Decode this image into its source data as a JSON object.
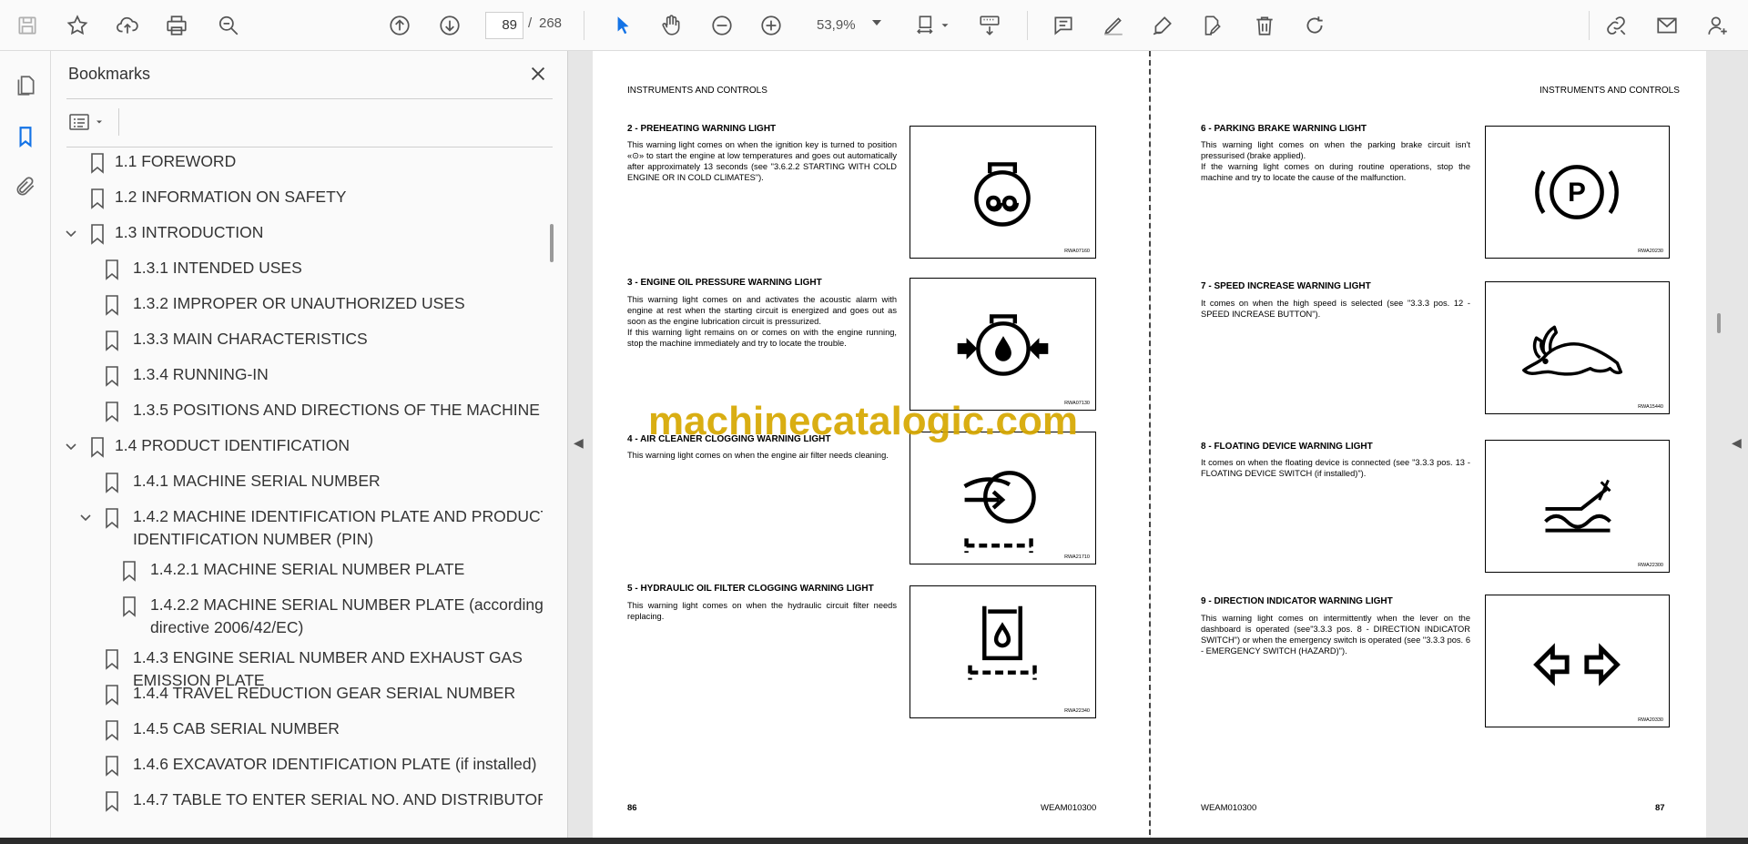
{
  "toolbar": {
    "page_current": "89",
    "page_separator": "/",
    "page_total": "268",
    "zoom_value": "53,9%"
  },
  "bookmarks": {
    "title": "Bookmarks",
    "items": [
      {
        "label": "1.1 FOREWORD",
        "level": 1,
        "expander": "none"
      },
      {
        "label": "1.2 INFORMATION ON SAFETY",
        "level": 1,
        "expander": "none"
      },
      {
        "label": "1.3 INTRODUCTION",
        "level": 1,
        "expander": "expanded"
      },
      {
        "label": "1.3.1 INTENDED USES",
        "level": 2,
        "expander": "none"
      },
      {
        "label": "1.3.2 IMPROPER OR UNAUTHORIZED USES",
        "level": 2,
        "expander": "none"
      },
      {
        "label": "1.3.3 MAIN CHARACTERISTICS",
        "level": 2,
        "expander": "none"
      },
      {
        "label": "1.3.4 RUNNING-IN",
        "level": 2,
        "expander": "none"
      },
      {
        "label": "1.3.5 POSITIONS AND DIRECTIONS OF THE MACHINE",
        "level": 2,
        "expander": "none"
      },
      {
        "label": "1.4 PRODUCT IDENTIFICATION",
        "level": 1,
        "expander": "expanded"
      },
      {
        "label": "1.4.1 MACHINE SERIAL NUMBER",
        "level": 2,
        "expander": "none"
      },
      {
        "label": "1.4.2 MACHINE IDENTIFICATION PLATE AND PRODUCT",
        "label2": "IDENTIFICATION NUMBER (PIN)",
        "level": 2,
        "expander": "expanded"
      },
      {
        "label": "1.4.2.1 MACHINE SERIAL NUMBER PLATE",
        "level": 3,
        "expander": "none"
      },
      {
        "label": "1.4.2.2 MACHINE SERIAL NUMBER PLATE (according",
        "label2": "directive 2006/42/EC)",
        "level": 3,
        "expander": "none"
      },
      {
        "label": "1.4.3 ENGINE SERIAL NUMBER AND EXHAUST GAS",
        "label2": "EMISSION PLATE",
        "level": 2,
        "expander": "none"
      },
      {
        "label": "1.4.4 TRAVEL REDUCTION GEAR SERIAL NUMBER",
        "level": 2,
        "expander": "none"
      },
      {
        "label": "1.4.5 CAB SERIAL NUMBER",
        "level": 2,
        "expander": "none"
      },
      {
        "label": "1.4.6 EXCAVATOR IDENTIFICATION PLATE (if installed)",
        "level": 2,
        "expander": "none"
      },
      {
        "label": "1.4.7 TABLE TO ENTER SERIAL NO. AND DISTRIBUTOR",
        "level": 2,
        "expander": "none"
      }
    ]
  },
  "document": {
    "left_page": {
      "header": "INSTRUMENTS AND CONTROLS",
      "footer_page": "86",
      "footer_code": "WEAM010300",
      "sections": [
        {
          "title": "2 -   PREHEATING WARNING LIGHT",
          "body": "This warning light comes on when the ignition key is turned to position «⊙» to start the engine at low temperatures and goes out automatically after approximately 13 seconds (see \"3.6.2.2 STARTING WITH COLD ENGINE OR IN COLD CLIMATES\").",
          "figure_code": "RWA07160",
          "icon": "preheating-icon"
        },
        {
          "title": "3 -   ENGINE OIL PRESSURE WARNING LIGHT",
          "body": "This warning light comes on and activates the acoustic alarm with engine at rest when the starting circuit is energized and goes out as soon as the engine lubrication circuit is pressurized.\nIf this warning light remains on or comes on with the engine running, stop the machine immediately and try to locate the trouble.",
          "figure_code": "RWA07130",
          "icon": "oil-pressure-icon"
        },
        {
          "title": "4 -   AIR CLEANER CLOGGING WARNING LIGHT",
          "body": "This warning light comes on when the engine air filter needs cleaning.",
          "figure_code": "RWA21710",
          "icon": "air-cleaner-icon"
        },
        {
          "title": "5 -   HYDRAULIC OIL FILTER CLOGGING WARNING LIGHT",
          "body": "This warning light comes on when the hydraulic circuit filter needs replacing.",
          "figure_code": "RWA22340",
          "icon": "hydraulic-filter-icon"
        }
      ]
    },
    "right_page": {
      "header": "INSTRUMENTS AND CONTROLS",
      "footer_page": "87",
      "footer_code": "WEAM010300",
      "sections": [
        {
          "title": "6 -   PARKING BRAKE WARNING LIGHT",
          "body": "This warning light comes on when the parking brake circuit isn't pressurised (brake applied).\nIf the warning light comes on during routine operations, stop the machine and try to locate the cause of the malfunction.",
          "figure_code": "RWA20230",
          "icon": "parking-brake-icon"
        },
        {
          "title": "7 -   SPEED INCREASE WARNING LIGHT",
          "body": "It comes on when the high speed is selected (see \"3.3.3  pos.  12 - SPEED INCREASE BUTTON\").",
          "figure_code": "RWA15440",
          "icon": "rabbit-icon"
        },
        {
          "title": "8 -   FLOATING DEVICE WARNING LIGHT",
          "body": "It comes on when the floating device is connected (see \"3.3.3 pos.  13 - FLOATING DEVICE SWITCH (if installed)\").",
          "figure_code": "RWA22300",
          "icon": "floating-device-icon"
        },
        {
          "title": "9 -   DIRECTION INDICATOR WARNING LIGHT",
          "body": "This warning light comes on intermittently when the lever on the dashboard is operated (see\"3.3.3  pos.  8 - DIRECTION INDICATOR SWITCH\") or when the emergency switch is operated (see \"3.3.3  pos.  6 - EMERGENCY SWITCH (HAZARD)\").",
          "figure_code": "RWA20330",
          "icon": "direction-indicator-icon"
        }
      ]
    },
    "watermark": "machinecatalogic.com"
  }
}
